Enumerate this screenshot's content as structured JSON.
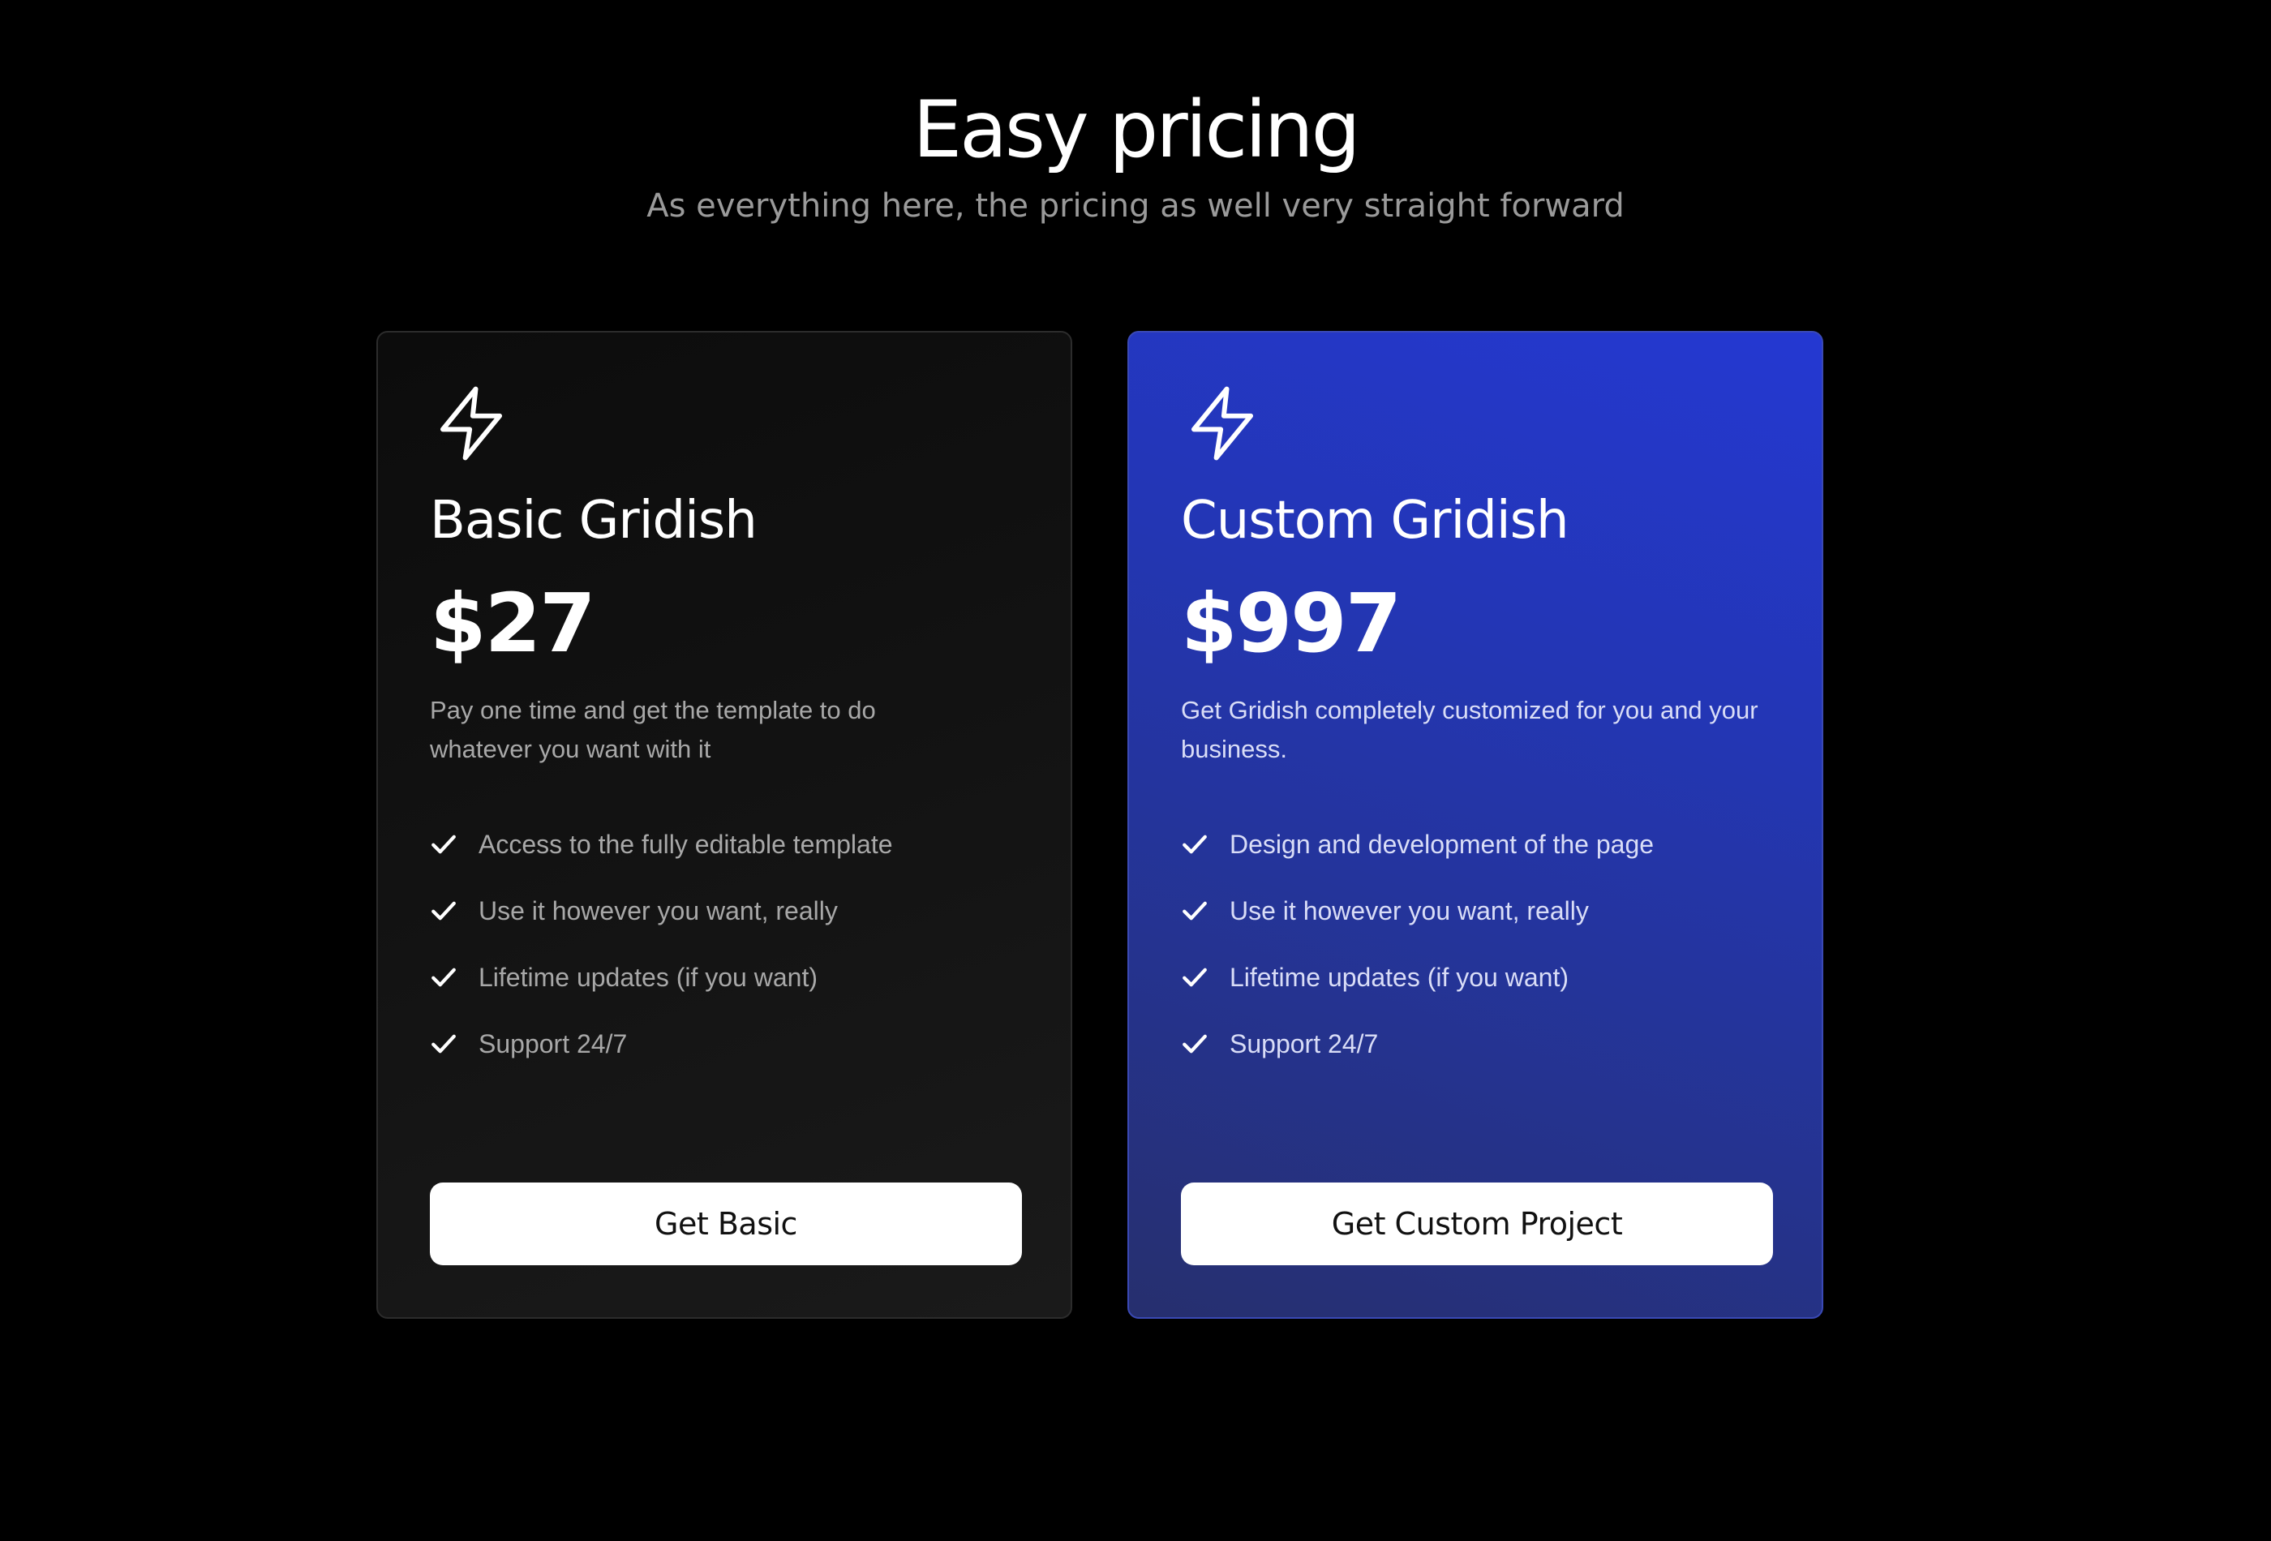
{
  "header": {
    "title": "Easy pricing",
    "subtitle": "As everything here, the pricing as well very straight forward"
  },
  "plans": [
    {
      "icon": "lightning-bolt-icon",
      "name": "Basic Gridish",
      "price": "$27",
      "description": "Pay one time and get the template to do whatever you want with it",
      "features": [
        "Access to the fully editable template",
        "Use it however you want, really",
        "Lifetime updates (if you want)",
        "Support 24/7"
      ],
      "cta_label": "Get Basic"
    },
    {
      "icon": "lightning-bolt-icon",
      "name": "Custom Gridish",
      "price": "$997",
      "description": "Get Gridish completely customized for you and your business.",
      "features": [
        "Design and development of the page",
        "Use it however you want, really",
        "Lifetime updates (if you want)",
        "Support 24/7"
      ],
      "cta_label": "Get Custom Project"
    }
  ],
  "colors": {
    "background": "#000000",
    "basic_card": "#121212",
    "custom_card_accent": "#2438d2",
    "button_bg": "#ffffff",
    "muted_text": "#a8a8a8"
  }
}
